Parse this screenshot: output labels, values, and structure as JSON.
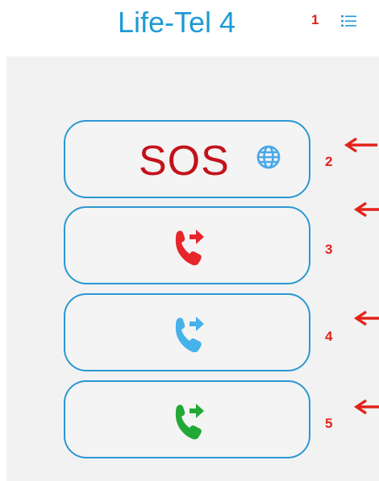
{
  "header": {
    "title": "Life-Tel 4",
    "callout_number": "1",
    "menu_icon": "list-menu-icon"
  },
  "buttons": [
    {
      "label": "SOS",
      "icon": "globe-icon",
      "label_color": "#c3121b",
      "icon_color": "#4aa8e8",
      "callout_number": "2"
    },
    {
      "icon": "phone-forward-icon",
      "icon_color": "#e6262b",
      "callout_number": "3"
    },
    {
      "icon": "phone-forward-icon",
      "icon_color": "#46b2ea",
      "callout_number": "4"
    },
    {
      "icon": "phone-forward-icon",
      "icon_color": "#22a836",
      "callout_number": "5"
    }
  ],
  "colors": {
    "title": "#1e9ad6",
    "button_border": "#2a97d2",
    "panel_background": "#f2f2f2",
    "callout": "#e2231a"
  }
}
